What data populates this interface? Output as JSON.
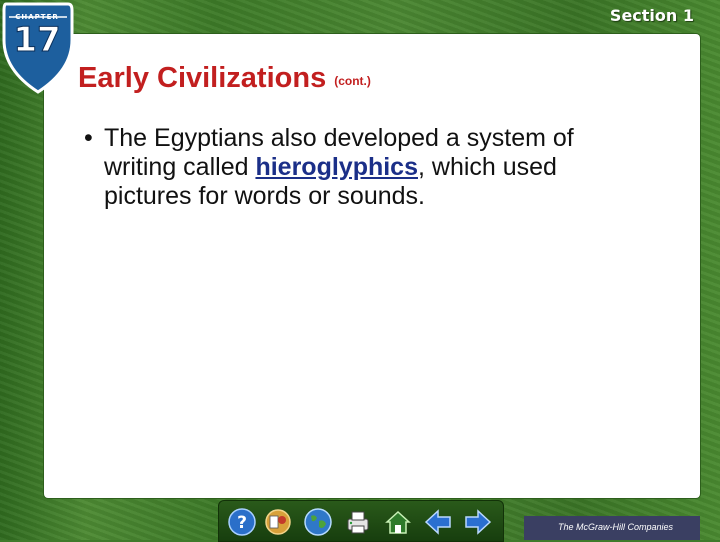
{
  "header": {
    "chapter_label": "CHAPTER",
    "chapter_number": "17",
    "section_label": "Section 1"
  },
  "slide": {
    "title": "Early Civilizations",
    "title_suffix": "(cont.)",
    "bullet": {
      "dot": "•",
      "text_before": "The Egyptians also developed a system of writing called ",
      "term": "hieroglyphics",
      "text_after": ", which used pictures for words or sounds."
    }
  },
  "nav": {
    "buttons": [
      "help-icon",
      "resource-icon",
      "globe-icon",
      "print-icon",
      "home-icon",
      "back-arrow-icon",
      "forward-arrow-icon"
    ]
  },
  "footer": {
    "publisher": "The McGraw-Hill Companies"
  },
  "colors": {
    "frame_green": "#3f7a2a",
    "title_red": "#c21f1f",
    "term_blue": "#1b2f88"
  }
}
